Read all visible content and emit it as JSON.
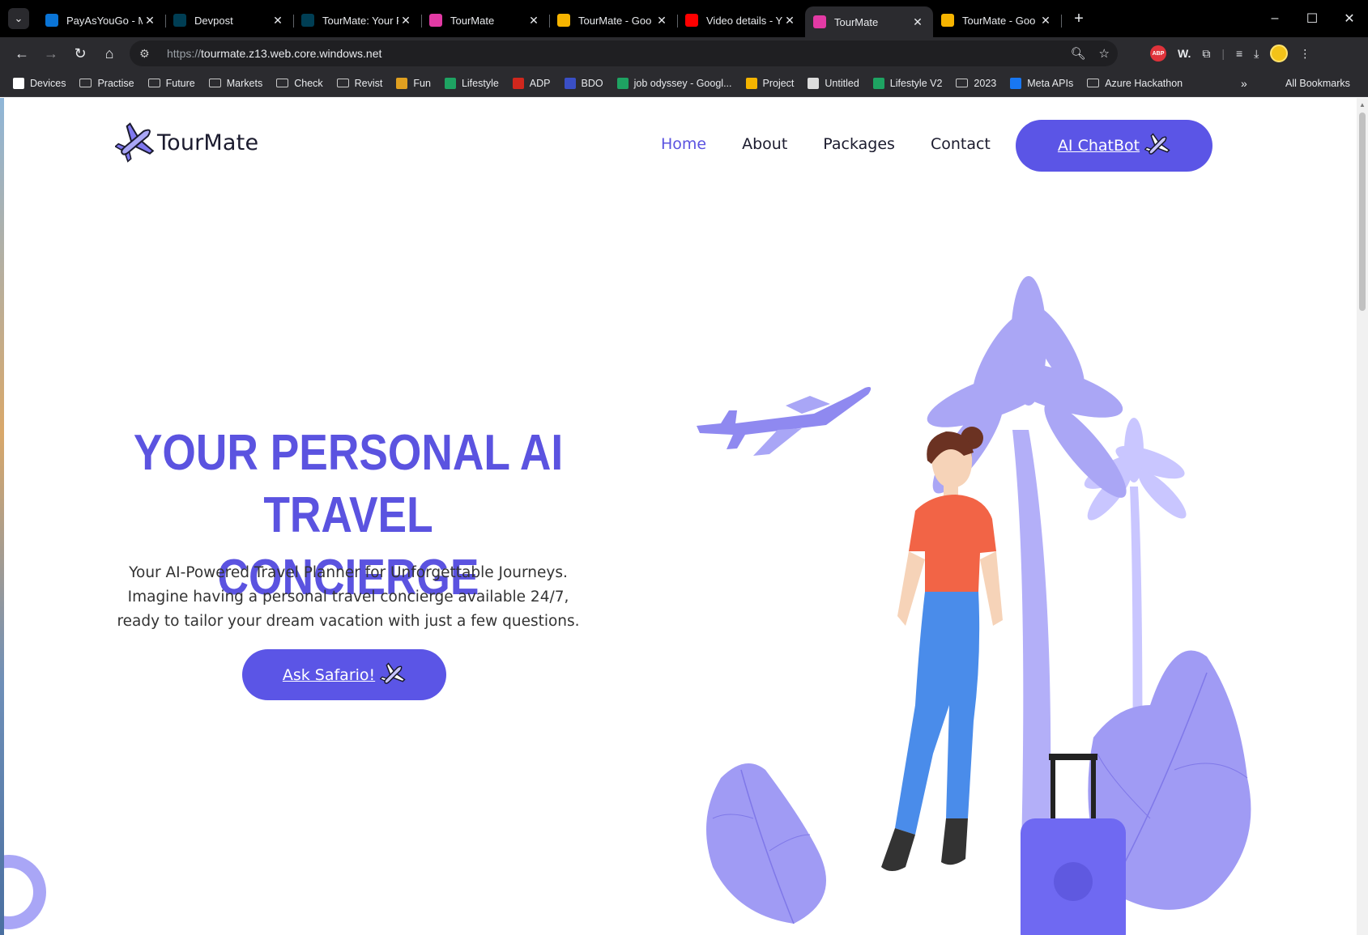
{
  "browser": {
    "tabs": [
      {
        "title": "PayAsYouGo - M",
        "favicon": "azure-icon",
        "color": "#0a74d6",
        "active": false
      },
      {
        "title": "Devpost",
        "favicon": "devpost-icon",
        "color": "#003e54",
        "active": false
      },
      {
        "title": "TourMate: Your F",
        "favicon": "devpost-icon",
        "color": "#003e54",
        "active": false
      },
      {
        "title": "TourMate",
        "favicon": "angular-icon",
        "color": "#e23aa4",
        "active": false
      },
      {
        "title": "TourMate - Goo",
        "favicon": "slides-icon",
        "color": "#f6b400",
        "active": false
      },
      {
        "title": "Video details - Y",
        "favicon": "youtube-icon",
        "color": "#ff0000",
        "active": false
      },
      {
        "title": "TourMate",
        "favicon": "angular-icon",
        "color": "#e23aa4",
        "active": true
      },
      {
        "title": "TourMate - Goo",
        "favicon": "slides-icon",
        "color": "#f6b400",
        "active": false
      }
    ],
    "url_scheme": "https://",
    "url_host": "tourmate.z13.web.core.windows.net",
    "bookmarks": [
      {
        "label": "Devices",
        "icon": "google-icon",
        "type": "site",
        "color": "#ffffff"
      },
      {
        "label": "Practise",
        "icon": "folder-icon",
        "type": "folder"
      },
      {
        "label": "Future",
        "icon": "folder-icon",
        "type": "folder"
      },
      {
        "label": "Markets",
        "icon": "folder-icon",
        "type": "folder"
      },
      {
        "label": "Check",
        "icon": "folder-icon",
        "type": "folder"
      },
      {
        "label": "Revist",
        "icon": "folder-icon",
        "type": "folder"
      },
      {
        "label": "Fun",
        "icon": "fun-icon",
        "type": "site",
        "color": "#e0a020"
      },
      {
        "label": "Lifestyle",
        "icon": "sheets-icon",
        "type": "site",
        "color": "#1ea362"
      },
      {
        "label": "ADP",
        "icon": "adp-icon",
        "type": "site",
        "color": "#d0271d"
      },
      {
        "label": "BDO",
        "icon": "bdo-icon",
        "type": "site",
        "color": "#3a4fc6"
      },
      {
        "label": "job odyssey - Googl...",
        "icon": "sheets-icon",
        "type": "site",
        "color": "#1ea362"
      },
      {
        "label": "Project",
        "icon": "drive-icon",
        "type": "site",
        "color": "#f4b400"
      },
      {
        "label": "Untitled",
        "icon": "globe-icon",
        "type": "site",
        "color": "#dddddd"
      },
      {
        "label": "Lifestyle V2",
        "icon": "sheets-icon",
        "type": "site",
        "color": "#1ea362"
      },
      {
        "label": "2023",
        "icon": "folder-icon",
        "type": "folder"
      },
      {
        "label": "Meta APIs",
        "icon": "facebook-icon",
        "type": "site",
        "color": "#1877f2"
      },
      {
        "label": "Azure Hackathon",
        "icon": "folder-icon",
        "type": "folder"
      }
    ],
    "all_bookmarks": "All Bookmarks",
    "more_bookmarks": "»"
  },
  "site": {
    "brand": "TourMate",
    "nav": [
      {
        "label": "Home",
        "active": true
      },
      {
        "label": "About",
        "active": false
      },
      {
        "label": "Packages",
        "active": false
      },
      {
        "label": "Contact",
        "active": false
      }
    ],
    "chatbot_label": "AI ChatBot",
    "accent": "#5b55e6",
    "hero": {
      "title_line1": "YOUR PERSONAL AI",
      "title_line2": "TRAVEL CONCIERGE",
      "text_line1": "Your AI-Powered Travel Planner for Unforgettable Journeys.",
      "text_line2": "Imagine having a personal travel concierge available 24/7,",
      "text_line3": "ready to tailor your dream vacation with just a few questions.",
      "cta_label": "Ask Safario!"
    }
  }
}
